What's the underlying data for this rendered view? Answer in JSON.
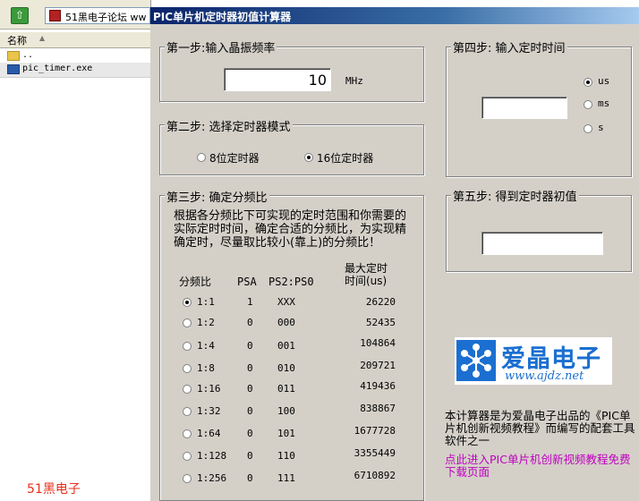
{
  "explorer": {
    "address": "51黑电子论坛 ww",
    "column_name": "名称",
    "files": [
      "..",
      "pic_timer.exe"
    ],
    "watermark": "51黑电子"
  },
  "window": {
    "title": "PIC单片机定时器初值计算器"
  },
  "step1": {
    "title": "第一步:输入晶振频率",
    "frequency": "10",
    "unit": "MHz"
  },
  "step2": {
    "title": "第二步: 选择定时器模式",
    "options": [
      "8位定时器",
      "16位定时器"
    ],
    "selected": "16位定时器"
  },
  "step3": {
    "title": "第三步: 确定分频比",
    "description": "根据各分频比下可实现的定时范围和你需要的实际定时时间，确定合适的分频比，为实现精确定时，尽量取比较小(靠上)的分频比！",
    "headers": {
      "ratio": "分频比",
      "psa": "PSA",
      "ps": "PS2:PS0",
      "max_line1": "最大定时",
      "max_line2": "时间(us)"
    },
    "selected_ratio": "1:1",
    "rows": [
      {
        "ratio": "1:1",
        "psa": "1",
        "ps": "XXX",
        "max": "26220"
      },
      {
        "ratio": "1:2",
        "psa": "0",
        "ps": "000",
        "max": "52435"
      },
      {
        "ratio": "1:4",
        "psa": "0",
        "ps": "001",
        "max": "104864"
      },
      {
        "ratio": "1:8",
        "psa": "0",
        "ps": "010",
        "max": "209721"
      },
      {
        "ratio": "1:16",
        "psa": "0",
        "ps": "011",
        "max": "419436"
      },
      {
        "ratio": "1:32",
        "psa": "0",
        "ps": "100",
        "max": "838867"
      },
      {
        "ratio": "1:64",
        "psa": "0",
        "ps": "101",
        "max": "1677728"
      },
      {
        "ratio": "1:128",
        "psa": "0",
        "ps": "110",
        "max": "3355449"
      },
      {
        "ratio": "1:256",
        "psa": "0",
        "ps": "111",
        "max": "6710892"
      }
    ]
  },
  "step4": {
    "title": "第四步: 输入定时时间",
    "value": "",
    "units": [
      "us",
      "ms",
      "s"
    ],
    "selected_unit": "us"
  },
  "step5": {
    "title": "第五步: 得到定时器初值",
    "result": ""
  },
  "logo": {
    "cn": "爱晶电子",
    "url": "www.ajdz.net"
  },
  "about": "本计算器是为爱晶电子出品的《PIC单片机创新视频教程》而编写的配套工具软件之一",
  "link": "点此进入PIC单片机创新视频教程免费下载页面",
  "colors": {
    "link": "#c000c0",
    "brand": "#1a6fd0",
    "watermark": "#e8301a"
  }
}
